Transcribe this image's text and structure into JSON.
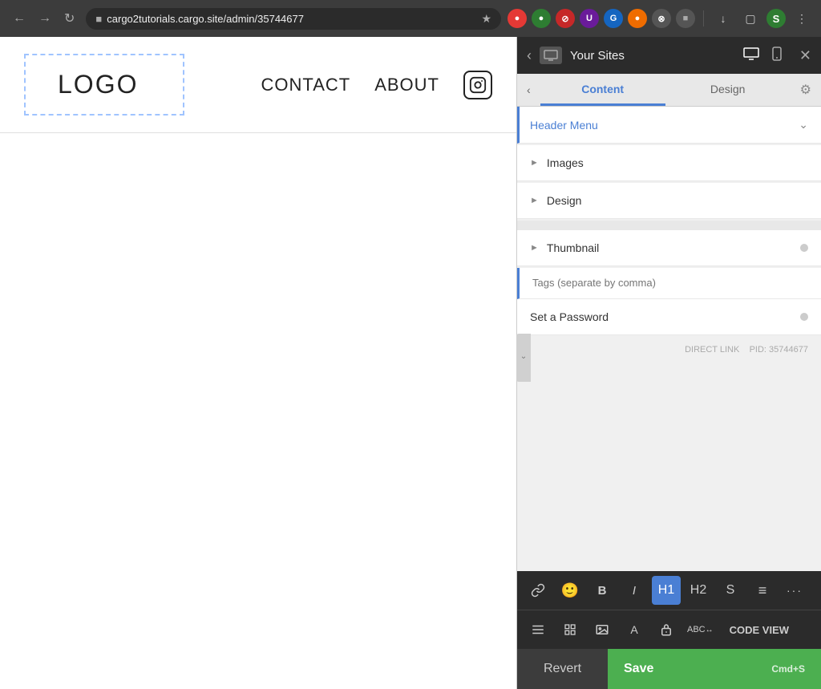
{
  "browser": {
    "url": "cargo2tutorials.cargo.site/admin/35744677",
    "nav_back": "←",
    "nav_forward": "→",
    "nav_reload": "↻",
    "star": "☆",
    "menu_dots": "⋮",
    "extensions": [
      "🔴",
      "🟢",
      "⛔",
      "U",
      "G",
      "🟠",
      "⊗",
      "🔒",
      "↓",
      "□",
      "S"
    ]
  },
  "site_preview": {
    "logo_text": "LOGO",
    "nav_items": [
      "CONTACT",
      "ABOUT"
    ],
    "instagram_icon": "⬡"
  },
  "right_panel": {
    "sites_label": "Your Sites",
    "back_arrow": "‹",
    "close": "✕",
    "device_desktop": "🖥",
    "device_mobile": "📱",
    "tabs": {
      "content_label": "Content",
      "design_label": "Design",
      "back_arrow": "‹",
      "settings_icon": "⚙"
    },
    "sections": {
      "header_menu": {
        "label": "Header Menu",
        "expanded": true,
        "chevron": "∨"
      },
      "images": {
        "label": "Images",
        "arrow": "▶"
      },
      "design": {
        "label": "Design",
        "arrow": "▶"
      },
      "thumbnail": {
        "label": "Thumbnail",
        "arrow": "▶",
        "dot": true
      },
      "set_password": {
        "label": "Set a Password",
        "dot": true
      }
    },
    "tags_placeholder": "Tags (separate by comma)",
    "footer": {
      "direct_link": "DIRECT LINK",
      "pid_label": "PID:",
      "pid_value": "35744677"
    }
  },
  "bottom_toolbar": {
    "row1": {
      "link_icon": "🔗",
      "emoji_icon": "🙂",
      "bold_label": "B",
      "italic_label": "I",
      "h1_label": "H1",
      "h2_label": "H2",
      "s_label": "S",
      "align_icon": "≡",
      "more_icon": "···"
    },
    "row2": {
      "list_icon": "≡",
      "grid_icon": "⊞",
      "image_icon": "🖼",
      "text_icon": "A",
      "lock_icon": "🔒",
      "abc_icon": "ABC",
      "code_view_label": "CODE VIEW"
    },
    "revert_label": "Revert",
    "save_label": "Save",
    "save_shortcut": "Cmd+S"
  }
}
